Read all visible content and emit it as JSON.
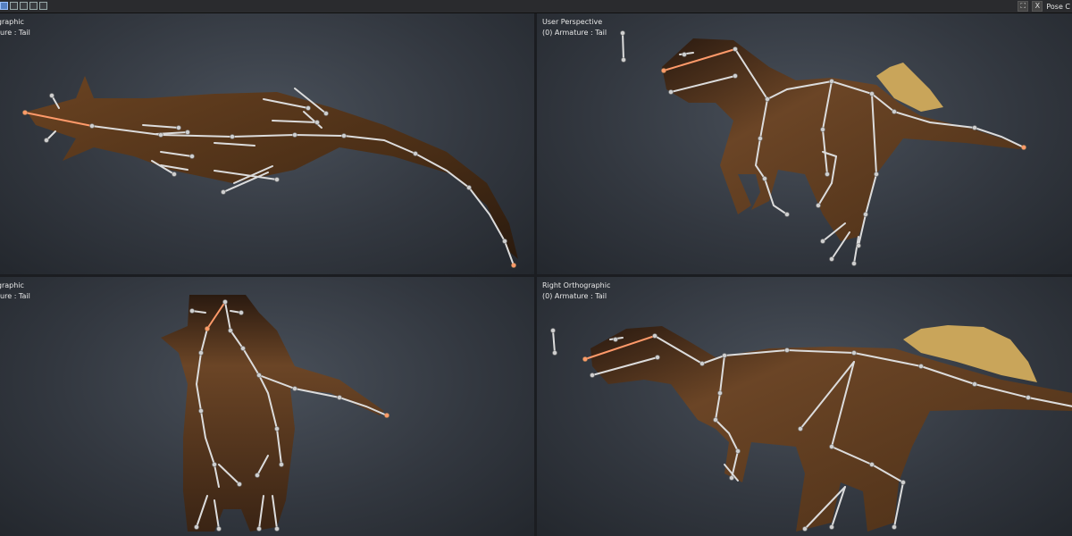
{
  "topbar": {
    "right_label": "Pose C",
    "close_label": "X"
  },
  "viewports": {
    "top_left": {
      "title": "ographic",
      "subtitle": "ature : Tail"
    },
    "top_right": {
      "title": "User Perspective",
      "subtitle": "(0) Armature : Tail"
    },
    "bottom_left": {
      "title": "ographic",
      "subtitle": "ature : Tail"
    },
    "bottom_right": {
      "title": "Right Orthographic",
      "subtitle": "(0) Armature : Tail"
    }
  },
  "colors": {
    "bone": "#dcdcdc",
    "selected_bone": "#ff9a6a",
    "skin_dark": "#2b1a10",
    "skin_mid": "#5c3a1f",
    "skin_light": "#7a5130",
    "feathers": "#c9a55a"
  }
}
